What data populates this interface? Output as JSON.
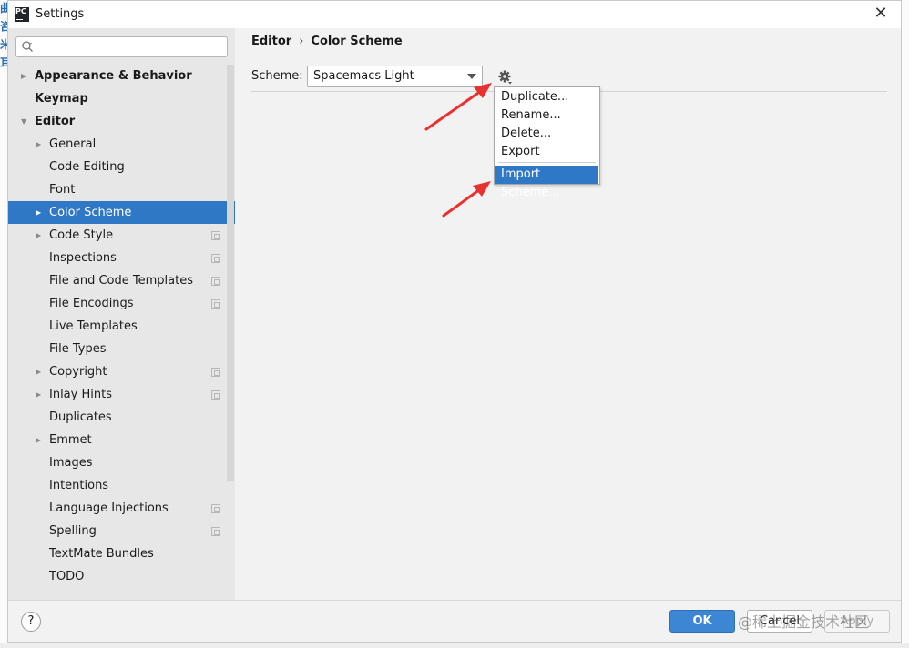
{
  "window": {
    "title": "Settings",
    "app_icon_text": "PC"
  },
  "search": {
    "placeholder": ""
  },
  "breadcrumb": {
    "parent": "Editor",
    "separator": "›",
    "current": "Color Scheme"
  },
  "scheme": {
    "label": "Scheme:",
    "selected": "Spacemacs Light"
  },
  "scheme_menu": {
    "items": [
      "Duplicate...",
      "Rename...",
      "Delete...",
      "Export"
    ],
    "import_item": "Import Scheme..."
  },
  "sidebar": {
    "items": [
      {
        "label": "Appearance & Behavior",
        "bold": true,
        "level": 0,
        "arrow": "collapsed",
        "copy": false
      },
      {
        "label": "Keymap",
        "bold": true,
        "level": 0,
        "arrow": "none",
        "copy": false
      },
      {
        "label": "Editor",
        "bold": true,
        "level": 0,
        "arrow": "expanded",
        "copy": false
      },
      {
        "label": "General",
        "bold": false,
        "level": 1,
        "arrow": "collapsed",
        "copy": false
      },
      {
        "label": "Code Editing",
        "bold": false,
        "level": 1,
        "arrow": "none",
        "copy": false
      },
      {
        "label": "Font",
        "bold": false,
        "level": 1,
        "arrow": "none",
        "copy": false
      },
      {
        "label": "Color Scheme",
        "bold": false,
        "level": 1,
        "arrow": "collapsed",
        "copy": false,
        "selected": true
      },
      {
        "label": "Code Style",
        "bold": false,
        "level": 1,
        "arrow": "collapsed",
        "copy": true
      },
      {
        "label": "Inspections",
        "bold": false,
        "level": 1,
        "arrow": "none",
        "copy": true
      },
      {
        "label": "File and Code Templates",
        "bold": false,
        "level": 1,
        "arrow": "none",
        "copy": true
      },
      {
        "label": "File Encodings",
        "bold": false,
        "level": 1,
        "arrow": "none",
        "copy": true
      },
      {
        "label": "Live Templates",
        "bold": false,
        "level": 1,
        "arrow": "none",
        "copy": false
      },
      {
        "label": "File Types",
        "bold": false,
        "level": 1,
        "arrow": "none",
        "copy": false
      },
      {
        "label": "Copyright",
        "bold": false,
        "level": 1,
        "arrow": "collapsed",
        "copy": true
      },
      {
        "label": "Inlay Hints",
        "bold": false,
        "level": 1,
        "arrow": "collapsed",
        "copy": true
      },
      {
        "label": "Duplicates",
        "bold": false,
        "level": 1,
        "arrow": "none",
        "copy": false
      },
      {
        "label": "Emmet",
        "bold": false,
        "level": 1,
        "arrow": "collapsed",
        "copy": false
      },
      {
        "label": "Images",
        "bold": false,
        "level": 1,
        "arrow": "none",
        "copy": false
      },
      {
        "label": "Intentions",
        "bold": false,
        "level": 1,
        "arrow": "none",
        "copy": false
      },
      {
        "label": "Language Injections",
        "bold": false,
        "level": 1,
        "arrow": "none",
        "copy": true
      },
      {
        "label": "Spelling",
        "bold": false,
        "level": 1,
        "arrow": "none",
        "copy": true
      },
      {
        "label": "TextMate Bundles",
        "bold": false,
        "level": 1,
        "arrow": "none",
        "copy": false
      },
      {
        "label": "TODO",
        "bold": false,
        "level": 1,
        "arrow": "none",
        "copy": false
      }
    ]
  },
  "footer": {
    "help": "?",
    "ok": "OK",
    "cancel": "Cancel",
    "apply": "Apply"
  },
  "watermark": "@稀土掘金技术社区",
  "colors": {
    "accent": "#2e78c6",
    "annotation_red": "#e8322f"
  }
}
